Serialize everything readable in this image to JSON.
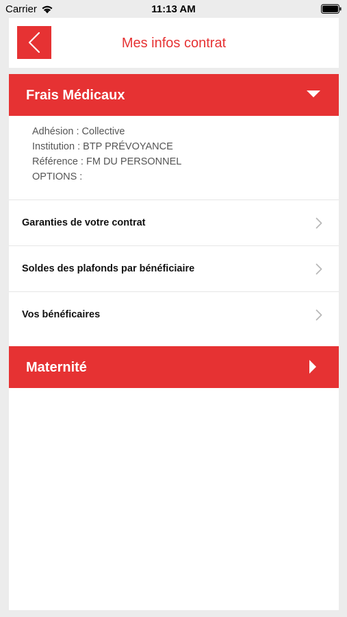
{
  "status_bar": {
    "carrier": "Carrier",
    "time": "11:13 AM"
  },
  "header": {
    "title": "Mes infos contrat",
    "back_icon": "chevron-left-icon"
  },
  "sections": [
    {
      "title": "Frais Médicaux",
      "expanded": true,
      "arrow_icon": "caret-down-icon",
      "info_lines": [
        "Adhésion : Collective",
        "Institution : BTP PRÉVOYANCE",
        "Référence : FM DU PERSONNEL",
        "OPTIONS :"
      ],
      "items": [
        {
          "label": "Garanties de votre contrat"
        },
        {
          "label": "Soldes des plafonds par bénéficiaire"
        },
        {
          "label": "Vos bénéficaires"
        }
      ]
    },
    {
      "title": "Maternité",
      "expanded": false,
      "arrow_icon": "caret-right-icon"
    }
  ],
  "colors": {
    "accent": "#e63233",
    "background": "#ececec",
    "panel": "#ffffff",
    "info_text": "#555555",
    "item_text": "#111111"
  }
}
